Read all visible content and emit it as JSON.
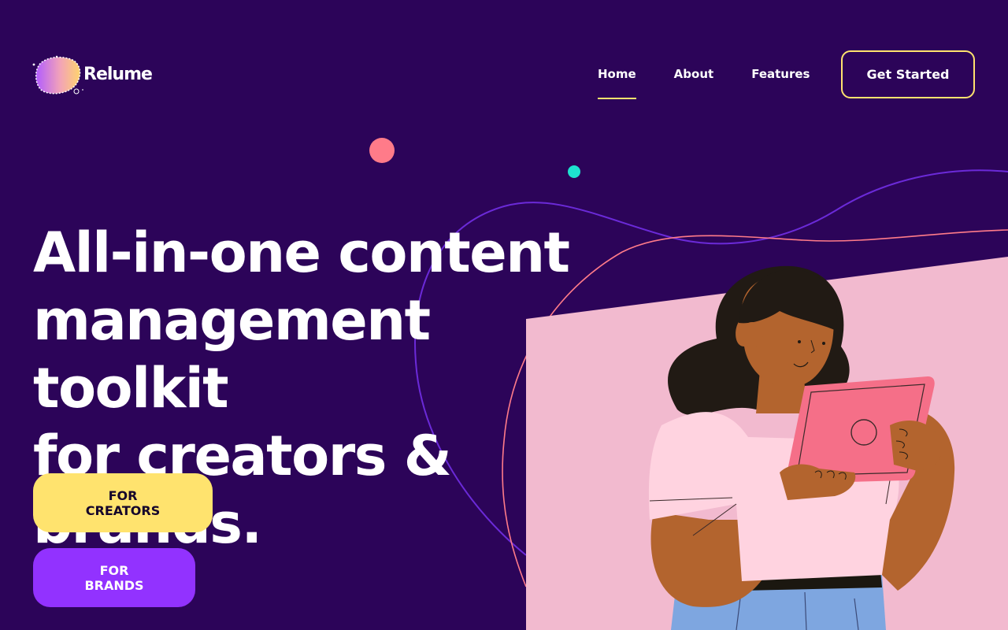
{
  "brand": {
    "name": "Relume"
  },
  "nav": {
    "items": [
      {
        "label": "Home",
        "active": true
      },
      {
        "label": "About",
        "active": false
      },
      {
        "label": "Features",
        "active": false
      }
    ],
    "cta_label": "Get Started"
  },
  "hero": {
    "title_lines": [
      "All-in-one content",
      "management toolkit",
      "for creators & brands."
    ],
    "buttons": {
      "creators_label": "FOR CREATORS",
      "brands_label": "FOR BRANDS"
    }
  },
  "illustration": {
    "icon": "woman-holding-tablet-illustration"
  },
  "colors": {
    "background": "#2c0459",
    "accent_yellow": "#ffe36e",
    "accent_purple": "#9232ff",
    "panel_pink": "#f2bacf",
    "dot_coral": "#ff7b89",
    "dot_teal": "#1ee3cf"
  }
}
